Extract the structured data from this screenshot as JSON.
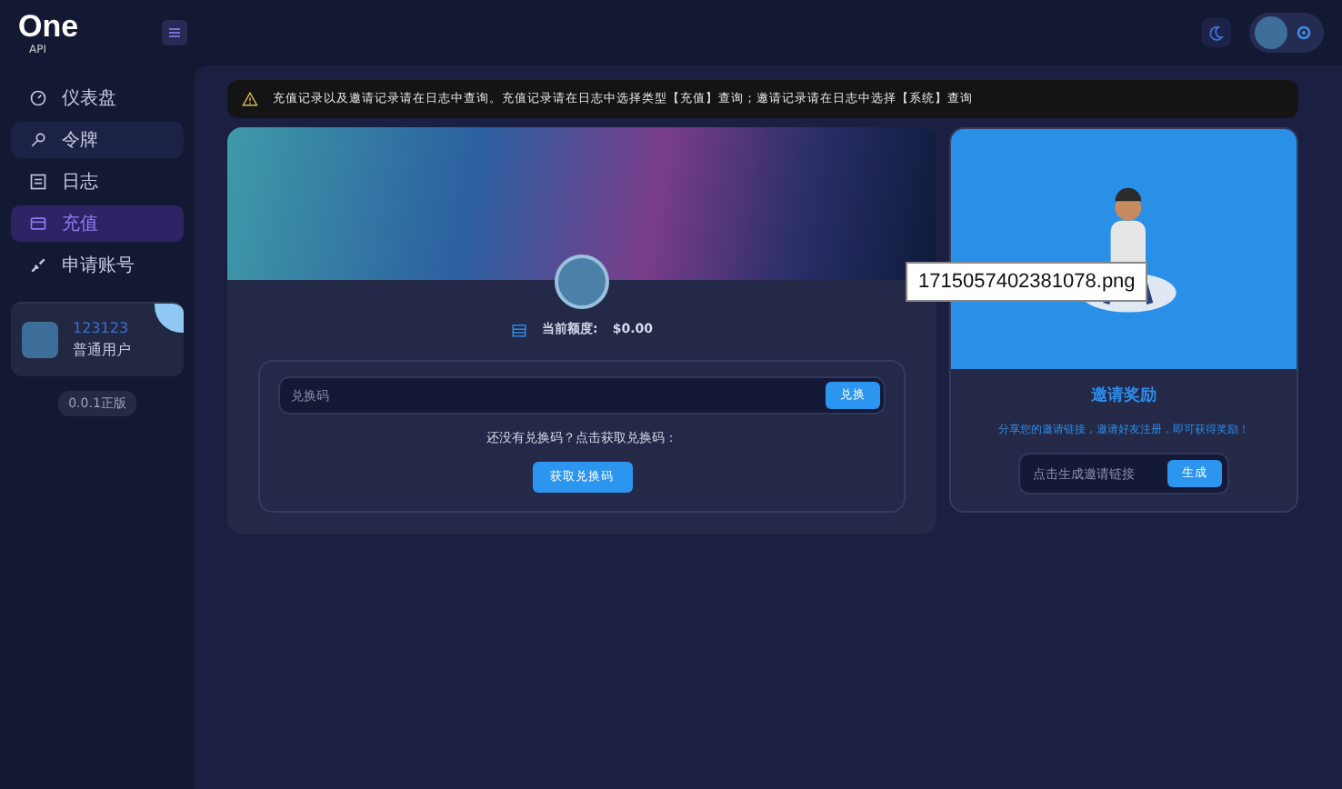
{
  "logo": {
    "title": "One",
    "subtitle": "API"
  },
  "sidebar": {
    "items": [
      {
        "label": "仪表盘",
        "selected": false
      },
      {
        "label": "令牌",
        "selected": false
      },
      {
        "label": "日志",
        "selected": false
      },
      {
        "label": "充值",
        "selected": true
      },
      {
        "label": "申请账号",
        "selected": false
      }
    ],
    "user": {
      "name": "123123",
      "role": "普通用户"
    },
    "version": "0.0.1正版"
  },
  "alert": "充值记录以及邀请记录请在日志中查询。充值记录请在日志中选择类型【充值】查询；邀请记录请在日志中选择【系统】查询",
  "balance": {
    "label": "当前额度:",
    "value": "$0.00"
  },
  "redeem": {
    "placeholder": "兑换码",
    "button": "兑换",
    "hint": "还没有兑换码？点击获取兑换码：",
    "get_button": "获取兑换码"
  },
  "invite": {
    "title": "邀请奖励",
    "description": "分享您的邀请链接，邀请好友注册，即可获得奖励！",
    "placeholder": "点击生成邀请链接",
    "button": "生成"
  },
  "image_label": "1715057402381078.png"
}
